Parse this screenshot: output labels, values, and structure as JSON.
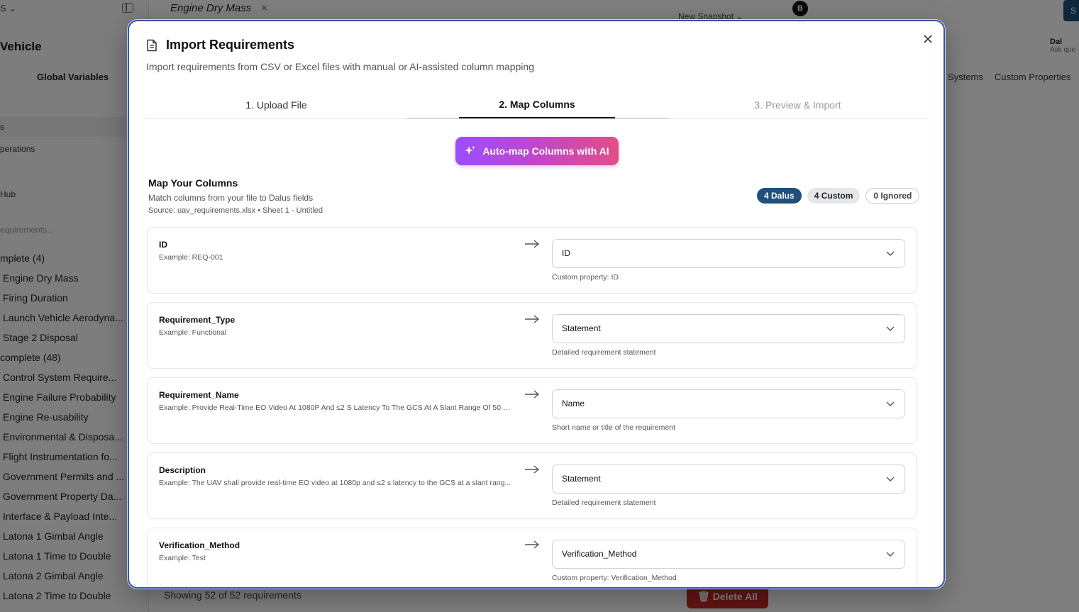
{
  "background": {
    "sidebar": {
      "top_label": "S",
      "title": "Vehicle",
      "tab": "Global Variables",
      "rows": [
        "s",
        "perations",
        "Hub"
      ],
      "search_placeholder": "equirements...",
      "group_complete": "mplete (4)",
      "complete_items": [
        "Engine Dry Mass",
        "Firing Duration",
        "Launch Vehicle Aerodyna...",
        "Stage 2 Disposal"
      ],
      "group_incomplete": "complete (48)",
      "incomplete_items": [
        "Control System Require...",
        "Engine Failure Probability",
        "Engine Re-usability",
        "Environmental & Disposa...",
        "Flight Instrumentation fo...",
        "Government Permits and ...",
        "Government Property Da...",
        "Interface & Payload Inte...",
        "Latona 1 Gimbal Angle",
        "Latona 1 Time to Double",
        "Latona 2 Gimbal Angle",
        "Latona 2 Time to Double"
      ]
    },
    "tab_title": "Engine Dry Mass",
    "tab_close": "×",
    "snapshot": "New Snapshot",
    "avatar": "B",
    "corner": "S",
    "assistant": {
      "name": "Dal",
      "sub": "Ask que"
    },
    "right_tabs": [
      "Systems",
      "Custom Properties"
    ],
    "footer_count": "Showing 52 of 52 requirements",
    "delete_all": "Delete All"
  },
  "modal": {
    "title": "Import Requirements",
    "description": "Import requirements from CSV or Excel files with manual or AI-assisted column mapping",
    "steps": [
      "1. Upload File",
      "2. Map Columns",
      "3. Preview & Import"
    ],
    "active_step": 1,
    "ai_button": "Auto-map Columns with AI",
    "map_title": "Map Your Columns",
    "map_subtitle": "Match columns from your file to Dalus fields",
    "source": "Source: uav_requirements.xlsx • Sheet 1 - Untitled",
    "badges": {
      "dalus": "4 Dalus",
      "custom": "4 Custom",
      "ignored": "0 Ignored"
    },
    "mappings": [
      {
        "column": "ID",
        "example": "Example: REQ-001",
        "target": "ID",
        "hint": "Custom property: ID"
      },
      {
        "column": "Requirement_Type",
        "example": "Example: Functional",
        "target": "Statement",
        "hint": "Detailed requirement statement"
      },
      {
        "column": "Requirement_Name",
        "example": "Example: Provide Real-Time EO Video At 1080P And ≤2 S Latency To The GCS At A Slant Range Of 50 K...",
        "target": "Name",
        "hint": "Short name or title of the requirement"
      },
      {
        "column": "Description",
        "example": "Example: The UAV shall provide real-time EO video at 1080p and ≤2 s latency to the GCS at a slant rang...",
        "target": "Statement",
        "hint": "Detailed requirement statement"
      },
      {
        "column": "Verification_Method",
        "example": "Example: Test",
        "target": "Verification_Method",
        "hint": "Custom property: Verification_Method"
      }
    ]
  },
  "colors": {
    "modal_border": "#3553a7",
    "dalus_badge": "#1f4f7a",
    "ai_gradient_start": "#9b4dff",
    "ai_gradient_end": "#e24f86",
    "delete_button": "#c62828"
  },
  "icons": {
    "title": "document-icon",
    "close": "close-icon",
    "ai": "sparkle-icon",
    "mapping": "arrow-right-icon",
    "select": "chevron-down-icon"
  }
}
